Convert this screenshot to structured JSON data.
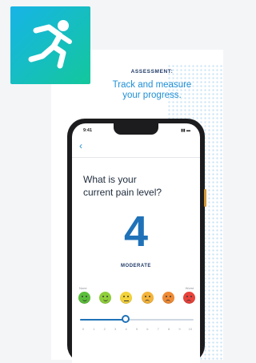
{
  "header": {
    "kicker": "ASSESSMENT:",
    "title_line1": "Track and measure",
    "title_line2": "your progress."
  },
  "app_icon": {
    "name": "running-person-icon",
    "gradient": [
      "#17b4e7",
      "#14c79c"
    ]
  },
  "phone": {
    "status_time": "9:41",
    "status_icons": "▮▮ ▬",
    "back_icon": "‹",
    "question_line1": "What is your",
    "question_line2": "current pain level?",
    "selected_value": "4",
    "selected_label": "MODERATE",
    "scale_min_label": "None",
    "scale_max_label": "Worst",
    "faces": [
      {
        "name": "face-very-happy",
        "color": "#5bbf3a"
      },
      {
        "name": "face-happy",
        "color": "#8fcf3a"
      },
      {
        "name": "face-neutral",
        "color": "#f2d23a"
      },
      {
        "name": "face-uneasy",
        "color": "#f4b43a"
      },
      {
        "name": "face-sad",
        "color": "#ef8a34"
      },
      {
        "name": "face-very-sad",
        "color": "#e8423a"
      }
    ],
    "slider_fraction": 0.4,
    "ticks": [
      "0",
      "1",
      "2",
      "3",
      "4",
      "5",
      "6",
      "7",
      "8",
      "9",
      "10"
    ]
  },
  "colors": {
    "accent": "#1f72b8",
    "title_blue": "#1f8fd6",
    "navy": "#1f3a68"
  }
}
